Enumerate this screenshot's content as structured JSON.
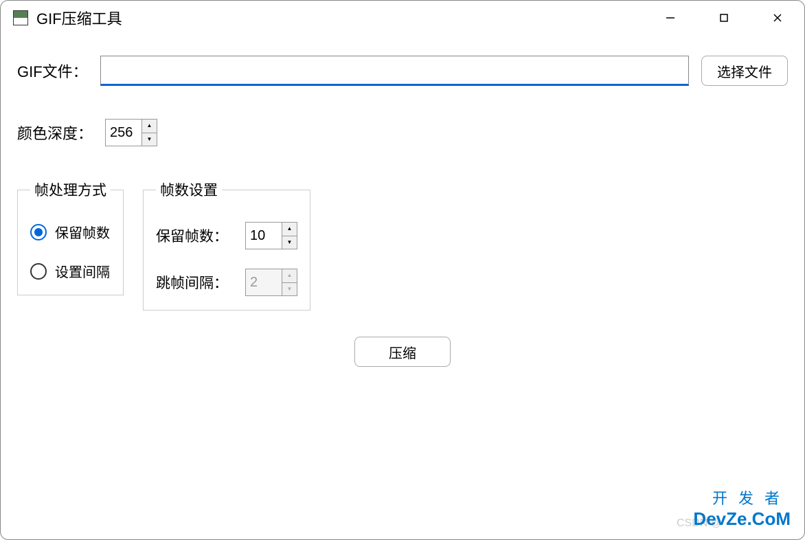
{
  "window": {
    "title": "GIF压缩工具"
  },
  "file": {
    "label": "GIF文件：",
    "value": "",
    "browse_button": "选择文件"
  },
  "color_depth": {
    "label": "颜色深度：",
    "value": "256"
  },
  "frame_mode": {
    "legend": "帧处理方式",
    "options": [
      {
        "label": "保留帧数",
        "checked": true
      },
      {
        "label": "设置间隔",
        "checked": false
      }
    ]
  },
  "frame_settings": {
    "legend": "帧数设置",
    "keep_frames": {
      "label": "保留帧数：",
      "value": "10",
      "enabled": true
    },
    "skip_interval": {
      "label": "跳帧间隔：",
      "value": "2",
      "enabled": false
    }
  },
  "compress_button": "压缩",
  "watermarks": {
    "devze_line1": "开发者",
    "devze_line2": "DevZe.CoM",
    "csdn": "CSDN @"
  }
}
